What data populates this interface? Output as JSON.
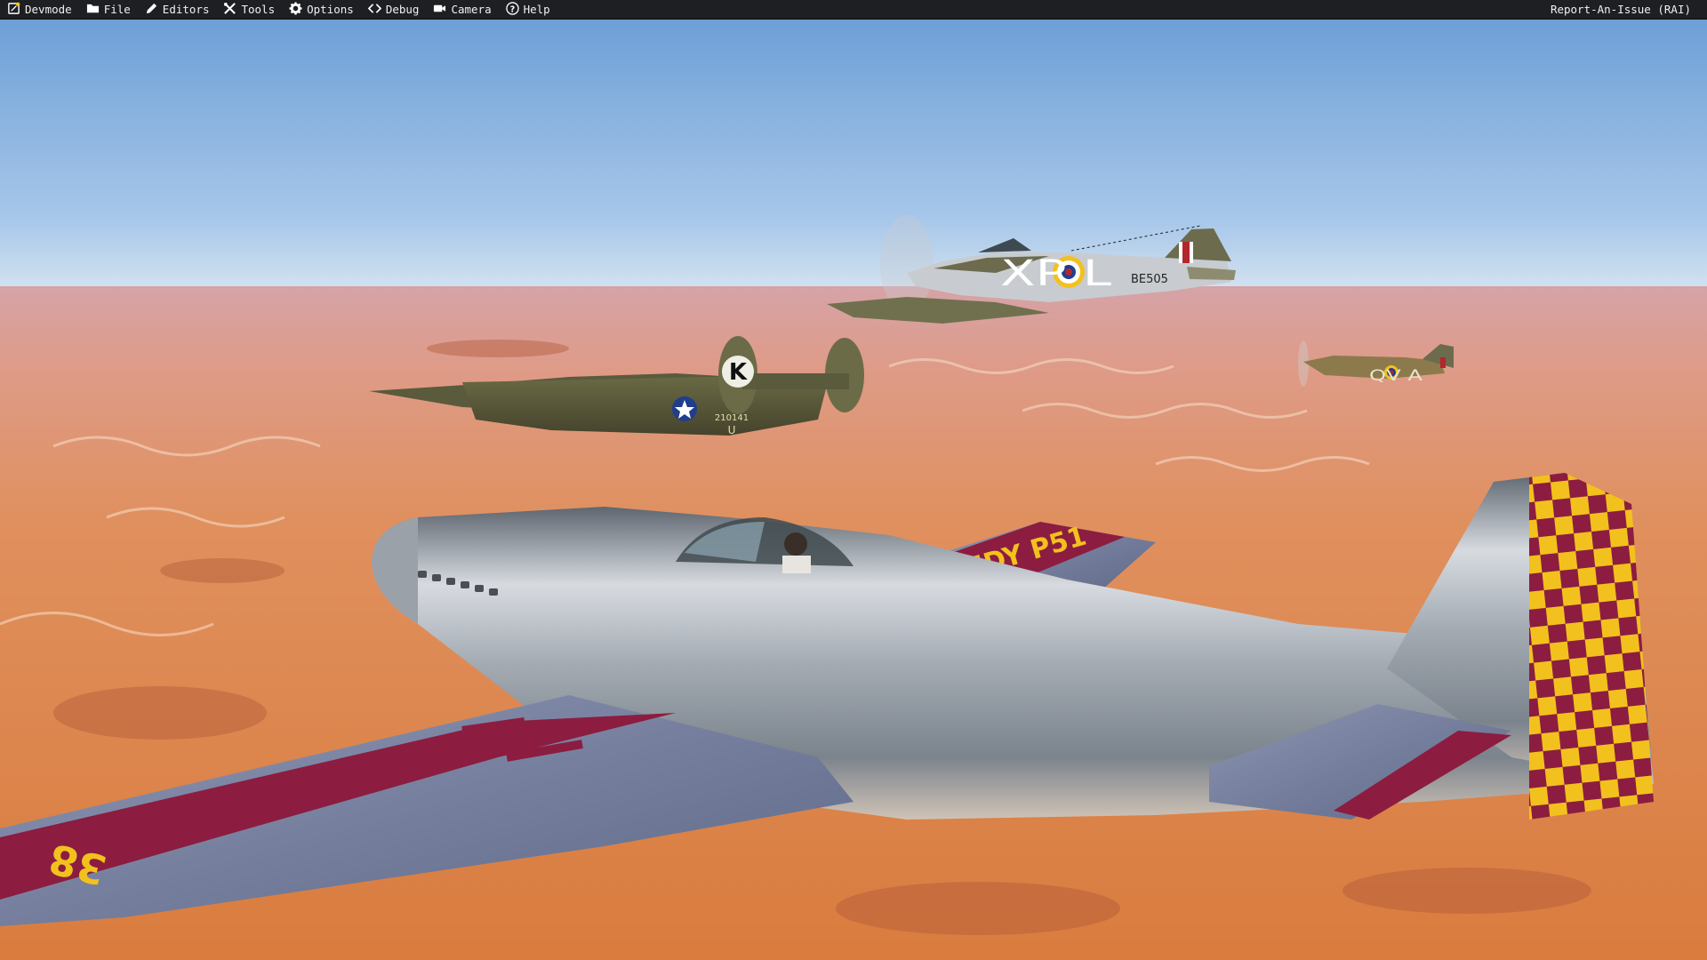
{
  "menubar": {
    "items": [
      {
        "label": "Devmode",
        "icon": "devmode-icon"
      },
      {
        "label": "File",
        "icon": "folder-icon"
      },
      {
        "label": "Editors",
        "icon": "pencil-icon"
      },
      {
        "label": "Tools",
        "icon": "tools-icon"
      },
      {
        "label": "Options",
        "icon": "gear-icon"
      },
      {
        "label": "Debug",
        "icon": "code-icon"
      },
      {
        "label": "Camera",
        "icon": "camera-icon"
      },
      {
        "label": "Help",
        "icon": "help-icon"
      }
    ],
    "report_label": "Report-An-Issue (RAI)"
  },
  "scene": {
    "hurricane_code": "XP L",
    "hurricane_serial": "BE505",
    "spitfire_code": "QV A",
    "liberator_letter": "K",
    "liberator_serial": "210141",
    "liberator_sub": "U",
    "p51_tail_text": "EDY P51",
    "p51_wing_number": "38"
  },
  "colors": {
    "menubar_bg": "#1d1f22",
    "sky_top": "#6d9fd6",
    "sky_horizon": "#c9def0",
    "desert": "#d9874f",
    "racing_red": "#8c1d40",
    "racing_yellow": "#f2c11d"
  }
}
